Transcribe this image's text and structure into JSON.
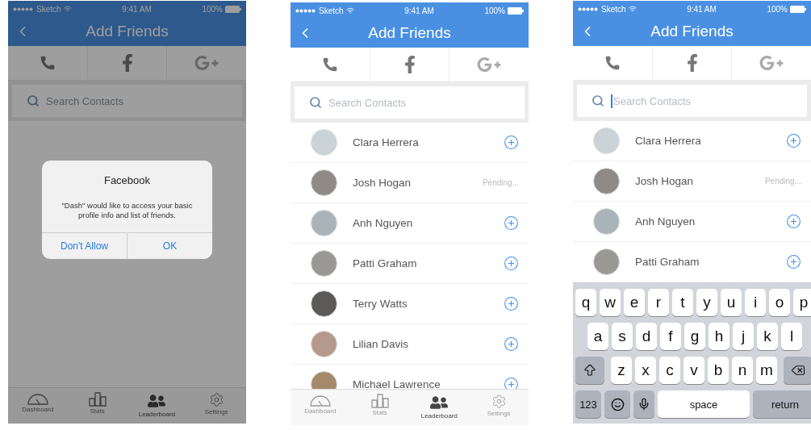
{
  "screens": [
    {
      "dimmed": true,
      "status_bar": {
        "carrier": "Sketch",
        "time": "9:41 AM",
        "battery": "100%"
      },
      "title": "Add Friends",
      "search": {
        "placeholder": "Search Contacts",
        "focused": false
      },
      "alert": {
        "title": "Facebook",
        "message": "\"Dash\" would like to access your basic profile info and list of friends.",
        "buttons": [
          "Don't Allow",
          "OK"
        ]
      },
      "tabs": [
        {
          "label": "Dashboard",
          "selected": false
        },
        {
          "label": "Stats",
          "selected": false
        },
        {
          "label": "Leaderboard",
          "selected": true
        },
        {
          "label": "Settings",
          "selected": false
        }
      ]
    },
    {
      "status_bar": {
        "carrier": "Sketch",
        "time": "9:41 AM",
        "battery": "100%"
      },
      "title": "Add Friends",
      "search": {
        "placeholder": "Search Contacts",
        "focused": false
      },
      "contacts": [
        {
          "name": "Clara Herrera",
          "kind": "add"
        },
        {
          "name": "Josh Hogan",
          "kind": "pending",
          "note": "Pending..."
        },
        {
          "name": "Anh Nguyen",
          "kind": "add"
        },
        {
          "name": "Patti Graham",
          "kind": "add"
        },
        {
          "name": "Terry Watts",
          "kind": "add"
        },
        {
          "name": "Lilian Davis",
          "kind": "add"
        },
        {
          "name": "Michael Lawrence",
          "kind": "add"
        }
      ],
      "tabs": [
        {
          "label": "Dashboard",
          "selected": false
        },
        {
          "label": "Stats",
          "selected": false
        },
        {
          "label": "Leaderboard",
          "selected": true
        },
        {
          "label": "Settings",
          "selected": false
        }
      ]
    },
    {
      "status_bar": {
        "carrier": "Sketch",
        "time": "9:41 AM",
        "battery": "100%"
      },
      "title": "Add Friends",
      "search": {
        "placeholder": "Search Contacts",
        "focused": true
      },
      "contacts": [
        {
          "name": "Clara Herrera",
          "kind": "add"
        },
        {
          "name": "Josh Hogan",
          "kind": "pending",
          "note": "Pending..."
        },
        {
          "name": "Anh Nguyen",
          "kind": "add"
        },
        {
          "name": "Patti Graham",
          "kind": "add"
        }
      ],
      "keyboard": {
        "rows": [
          [
            "q",
            "w",
            "e",
            "r",
            "t",
            "y",
            "u",
            "i",
            "o",
            "p"
          ],
          [
            "a",
            "s",
            "d",
            "f",
            "g",
            "h",
            "j",
            "k",
            "l"
          ],
          [
            "z",
            "x",
            "c",
            "v",
            "b",
            "n",
            "m"
          ]
        ],
        "numbers": "123",
        "space": "space",
        "return": "return"
      }
    }
  ]
}
